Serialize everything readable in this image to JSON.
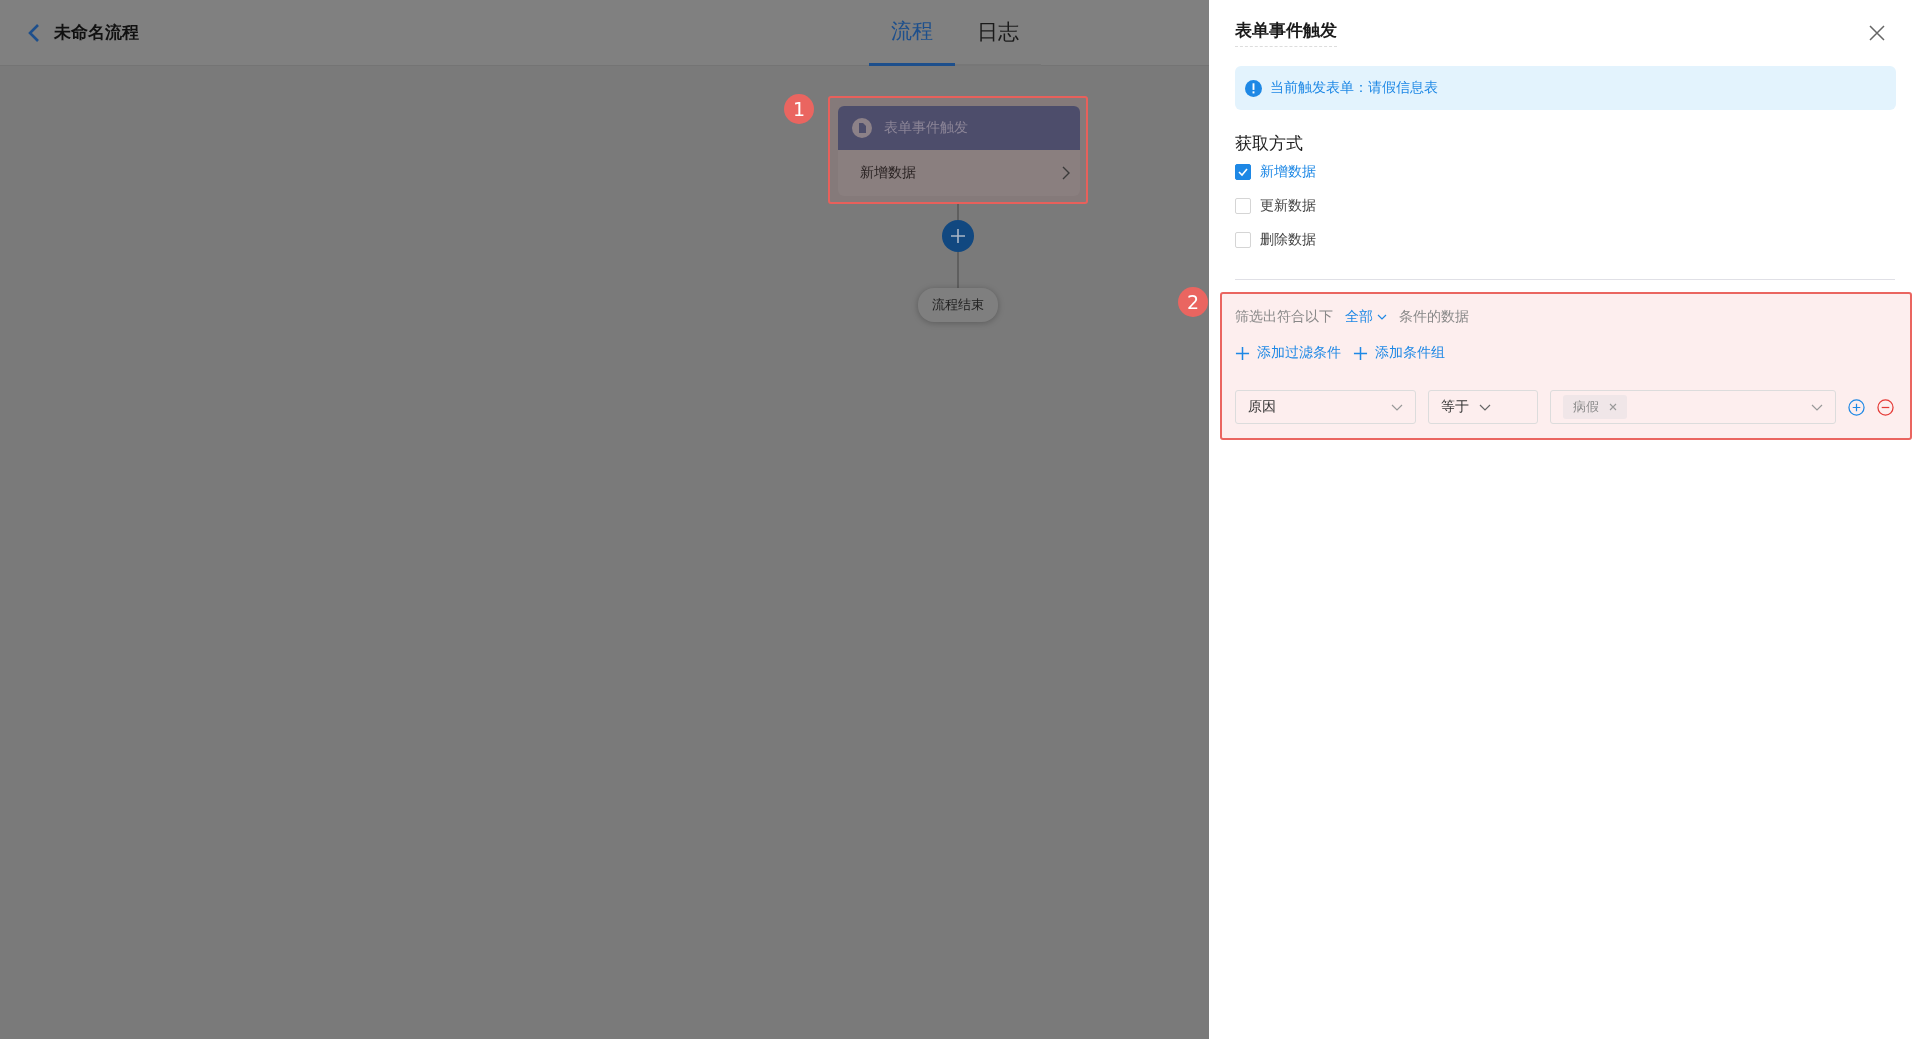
{
  "header": {
    "title": "未命名流程"
  },
  "tabs": [
    {
      "label": "流程",
      "selected": true
    },
    {
      "label": "日志",
      "selected": false
    }
  ],
  "flow": {
    "annotation": "1",
    "trigger": {
      "title": "表单事件触发",
      "action": "新增数据"
    },
    "end": "流程结束"
  },
  "drawer": {
    "title": "表单事件触发",
    "notice": "当前触发表单：请假信息表",
    "fetch": {
      "label": "获取方式",
      "options": [
        {
          "label": "新增数据",
          "checked": true
        },
        {
          "label": "更新数据",
          "checked": false
        },
        {
          "label": "删除数据",
          "checked": false
        }
      ]
    },
    "filter": {
      "annotation": "2",
      "prefix": "筛选出符合以下",
      "match": "全部",
      "suffix": "条件的数据",
      "actions": [
        "添加过滤条件",
        "添加条件组"
      ],
      "conditions": [
        {
          "field": "原因",
          "operator": "等于",
          "values": [
            "病假"
          ]
        }
      ]
    }
  }
}
